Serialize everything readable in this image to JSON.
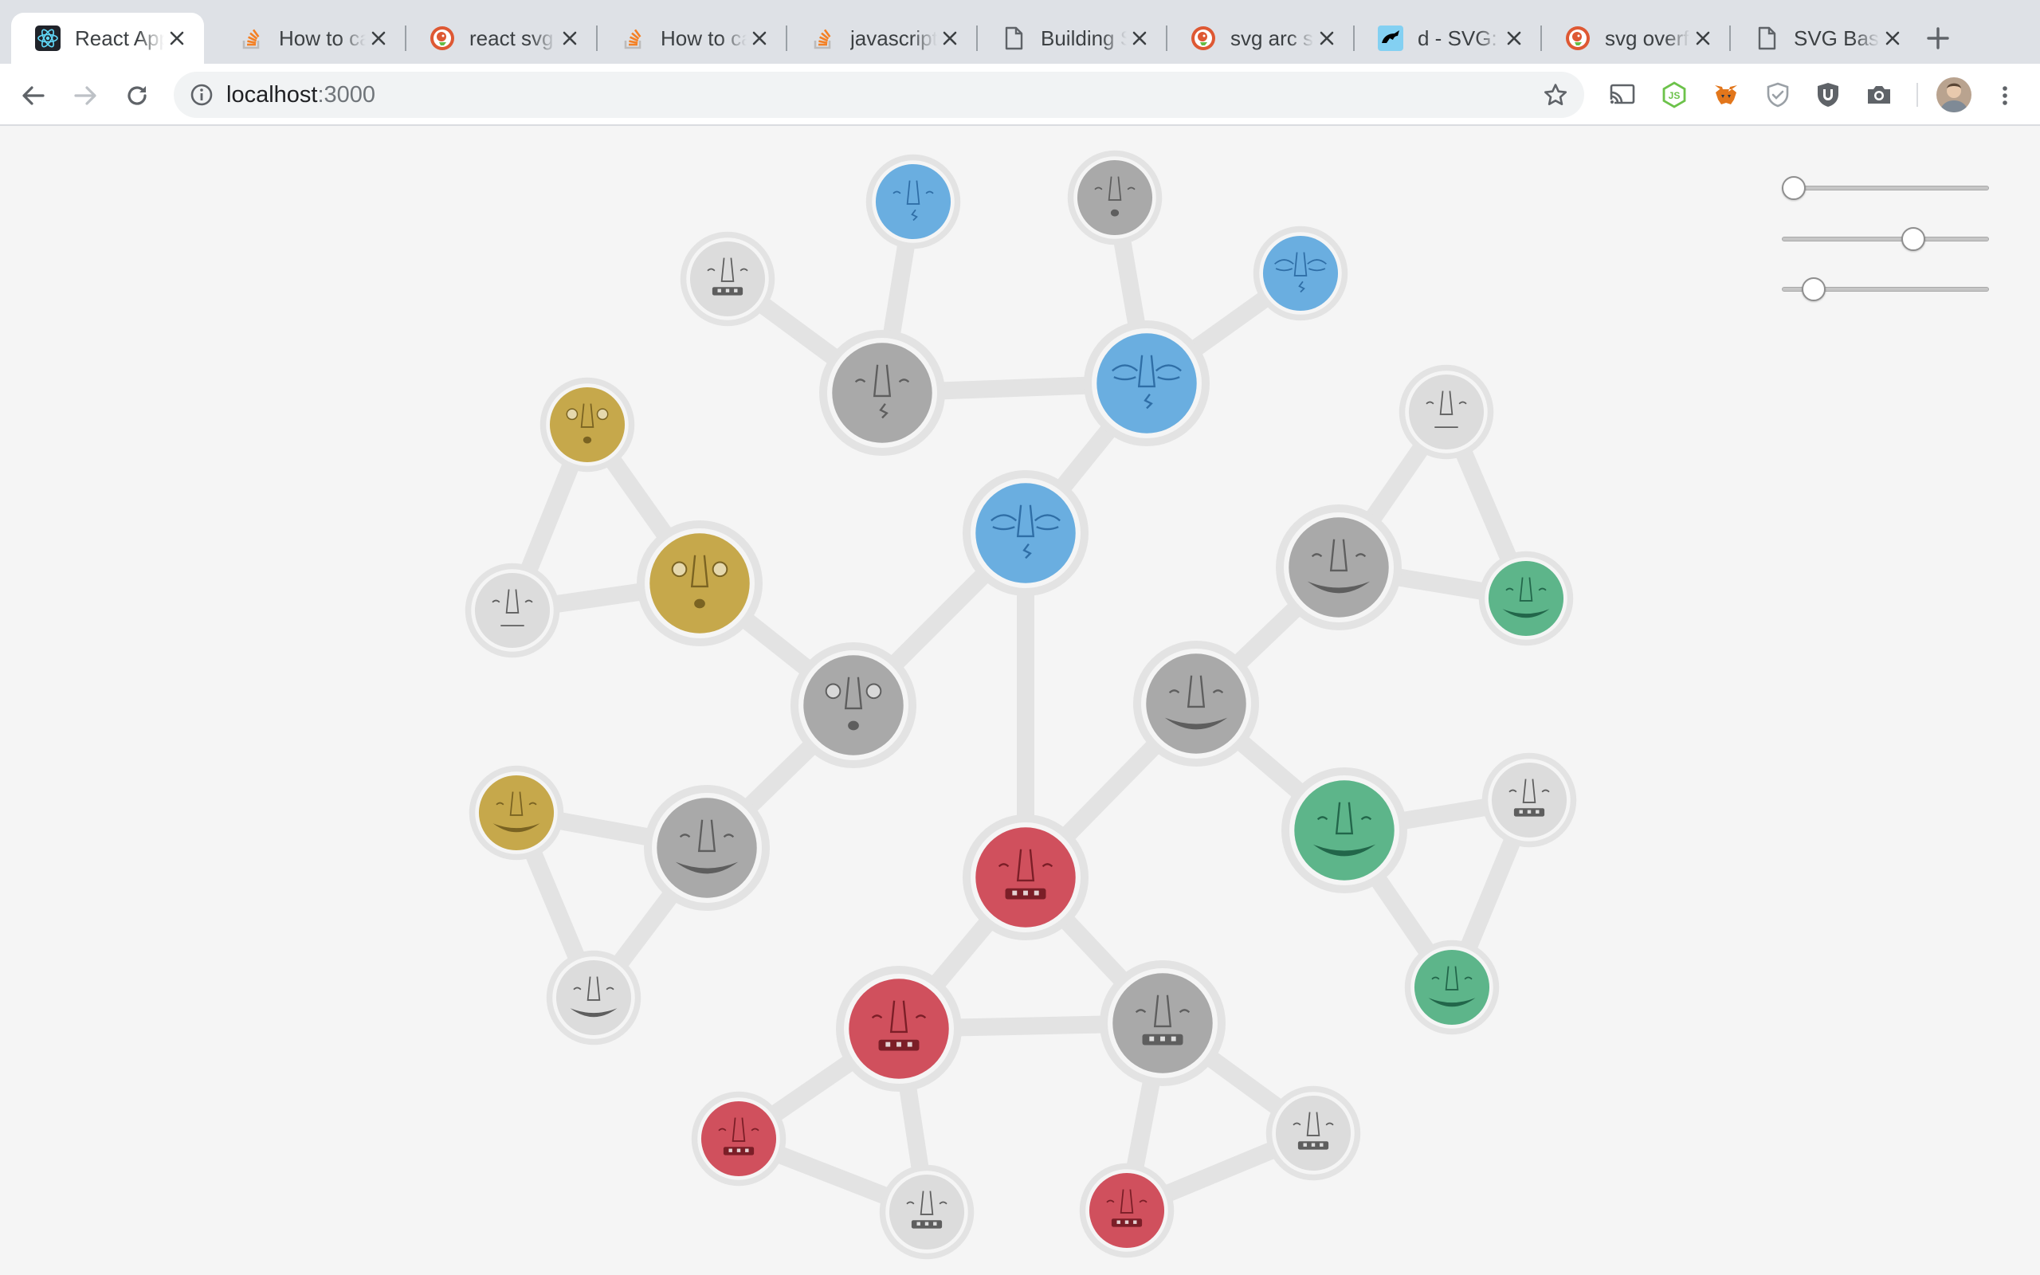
{
  "browser": {
    "tabs": [
      {
        "title": "React App",
        "favicon": "react-icon",
        "active": true
      },
      {
        "title": "How to calculate",
        "favicon": "stackoverflow-icon",
        "active": false
      },
      {
        "title": "react svg arc",
        "favicon": "duckduckgo-icon",
        "active": false
      },
      {
        "title": "How to calculate",
        "favicon": "stackoverflow-icon",
        "active": false
      },
      {
        "title": "javascript",
        "favicon": "stackoverflow-icon",
        "active": false
      },
      {
        "title": "Building SVG",
        "favicon": "document-icon",
        "active": false
      },
      {
        "title": "svg arc segment",
        "favicon": "duckduckgo-icon",
        "active": false
      },
      {
        "title": "d - SVG: Scalable",
        "favicon": "mdn-icon",
        "active": false
      },
      {
        "title": "svg overflow",
        "favicon": "duckduckgo-icon",
        "active": false
      },
      {
        "title": "SVG Basic Shapes",
        "favicon": "document-icon",
        "active": false
      }
    ],
    "address": {
      "host": "localhost",
      "port": ":3000"
    },
    "extensions": [
      "cast-icon",
      "nodejs-icon",
      "metamask-icon",
      "shield-check-icon",
      "ublock-icon",
      "camera-icon"
    ]
  },
  "sliders": [
    {
      "name": "slider-1",
      "value": 0.0
    },
    {
      "name": "slider-2",
      "value": 0.65
    },
    {
      "name": "slider-3",
      "value": 0.11
    }
  ],
  "tree": {
    "colors": {
      "blue": "#6aaee0",
      "gold": "#c6a84b",
      "gray": "#a9a9a9",
      "red": "#d0505d",
      "green": "#5db58a",
      "ring": "#e3e3e3",
      "link": "#e3e3e3"
    },
    "nodes": [
      {
        "id": "root-blue",
        "color": "blue",
        "face": "dizzy"
      },
      {
        "id": "blue-1",
        "color": "blue",
        "face": "dizzy"
      },
      {
        "id": "blue-leaf-a",
        "color": "blue",
        "face": "dizzy"
      },
      {
        "id": "blue-leaf-b",
        "color": "gray",
        "face": "open-mouth"
      },
      {
        "id": "gray-1",
        "color": "gray",
        "face": "calm"
      },
      {
        "id": "gray-leaf-a",
        "color": "gray",
        "face": "teeth"
      },
      {
        "id": "blue-leaf-c",
        "color": "blue",
        "face": "calm"
      },
      {
        "id": "gray-big",
        "color": "gray",
        "face": "surprised"
      },
      {
        "id": "gold-1",
        "color": "gold",
        "face": "surprised"
      },
      {
        "id": "gold-leaf-a",
        "color": "gold",
        "face": "surprised"
      },
      {
        "id": "gray-leaf-b",
        "color": "gray",
        "face": "flat"
      },
      {
        "id": "gray-2",
        "color": "gray",
        "face": "grin"
      },
      {
        "id": "gold-leaf-b",
        "color": "gold",
        "face": "grin"
      },
      {
        "id": "gray-leaf-c",
        "color": "gray",
        "face": "grin"
      },
      {
        "id": "gray-smile",
        "color": "gray",
        "face": "grin"
      },
      {
        "id": "gray-3",
        "color": "gray",
        "face": "grin"
      },
      {
        "id": "gray-leaf-d",
        "color": "gray",
        "face": "flat"
      },
      {
        "id": "green-leaf-a",
        "color": "green",
        "face": "grin"
      },
      {
        "id": "green-1",
        "color": "green",
        "face": "grin"
      },
      {
        "id": "gray-leaf-e",
        "color": "gray",
        "face": "teeth"
      },
      {
        "id": "green-leaf-b",
        "color": "green",
        "face": "grin"
      },
      {
        "id": "red-root",
        "color": "red",
        "face": "teeth"
      },
      {
        "id": "red-1",
        "color": "red",
        "face": "teeth"
      },
      {
        "id": "red-leaf-a",
        "color": "red",
        "face": "teeth"
      },
      {
        "id": "gray-leaf-f",
        "color": "gray",
        "face": "teeth"
      },
      {
        "id": "gray-4",
        "color": "gray",
        "face": "teeth"
      },
      {
        "id": "red-leaf-b",
        "color": "red",
        "face": "teeth"
      },
      {
        "id": "gray-leaf-g",
        "color": "gray",
        "face": "teeth"
      }
    ]
  }
}
